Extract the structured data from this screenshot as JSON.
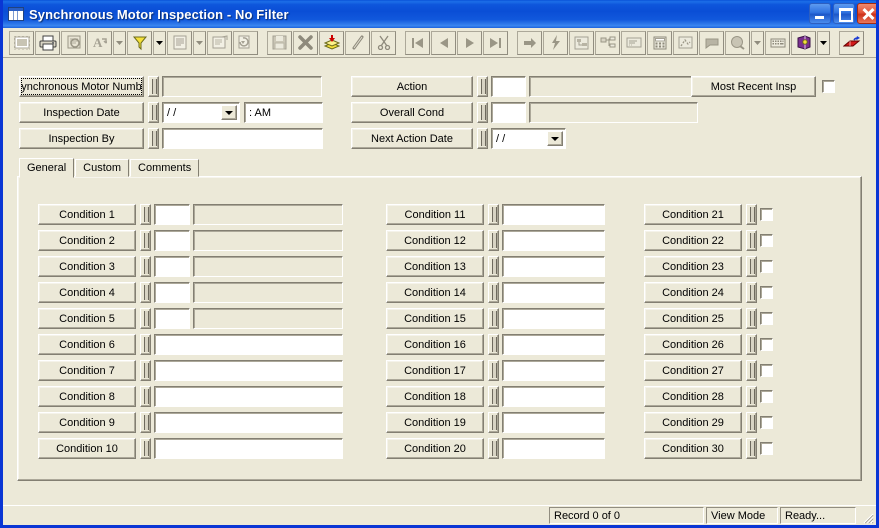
{
  "window": {
    "title": "Synchronous Motor Inspection - No Filter",
    "icon": "grid-table-icon",
    "minimize_label": "Minimize",
    "maximize_label": "Maximize",
    "close_label": "Close"
  },
  "toolbar": {
    "items": [
      {
        "name": "select-all-icon",
        "tip": "Select All",
        "disabled": true
      },
      {
        "name": "print-icon",
        "tip": "Print",
        "disabled": false
      },
      {
        "name": "print-preview-icon",
        "tip": "Print Preview",
        "disabled": true
      },
      {
        "name": "find-icon",
        "tip": "Find",
        "disabled": true
      },
      {
        "name": "find-dropdown-arrow",
        "tip": "Find Options",
        "disabled": true
      },
      {
        "name": "filter-icon",
        "tip": "Filter",
        "disabled": false
      },
      {
        "name": "filter-dropdown-arrow",
        "tip": "Filter Options",
        "disabled": false
      },
      {
        "name": "report-icon",
        "tip": "Report",
        "disabled": true
      },
      {
        "name": "report-dropdown-arrow",
        "tip": "Report Options",
        "disabled": true
      },
      {
        "name": "properties-icon",
        "tip": "Properties",
        "disabled": true
      },
      {
        "name": "refresh-icon",
        "tip": "Refresh",
        "disabled": true
      },
      {
        "name": "save-icon",
        "tip": "Save",
        "disabled": true
      },
      {
        "name": "delete-icon",
        "tip": "Delete",
        "disabled": true
      },
      {
        "name": "add-record-icon",
        "tip": "Add Record",
        "disabled": false
      },
      {
        "name": "edit-icon",
        "tip": "Edit",
        "disabled": true
      },
      {
        "name": "cut-icon",
        "tip": "Cut",
        "disabled": true
      },
      {
        "name": "first-record-icon",
        "tip": "First Record",
        "disabled": true
      },
      {
        "name": "previous-record-icon",
        "tip": "Previous Record",
        "disabled": true
      },
      {
        "name": "next-record-icon",
        "tip": "Next Record",
        "disabled": true
      },
      {
        "name": "last-record-icon",
        "tip": "Last Record",
        "disabled": true
      },
      {
        "name": "goto-record-icon",
        "tip": "Go To Record",
        "disabled": true
      },
      {
        "name": "lightning-icon",
        "tip": "Run",
        "disabled": true
      },
      {
        "name": "hierarchy-icon",
        "tip": "Hierarchy",
        "disabled": true
      },
      {
        "name": "org-chart-icon",
        "tip": "Structure",
        "disabled": true
      },
      {
        "name": "notes-icon",
        "tip": "Notes",
        "disabled": true
      },
      {
        "name": "calculator-icon",
        "tip": "Calculator",
        "disabled": true
      },
      {
        "name": "attachment-icon",
        "tip": "Attachments",
        "disabled": true
      },
      {
        "name": "comment-icon",
        "tip": "Comments",
        "disabled": true
      },
      {
        "name": "help-search-icon",
        "tip": "Search Help",
        "disabled": true
      },
      {
        "name": "help-dropdown-arrow",
        "tip": "Help Options",
        "disabled": true
      },
      {
        "name": "keyboard-icon",
        "tip": "Keyboard",
        "disabled": true
      },
      {
        "name": "book-icon",
        "tip": "Manual",
        "disabled": false
      },
      {
        "name": "book-dropdown-arrow",
        "tip": "Manual Options",
        "disabled": false
      },
      {
        "name": "exit-icon",
        "tip": "Exit",
        "disabled": false
      }
    ]
  },
  "header": {
    "left_fields": [
      {
        "label": "ynchronous Motor Numb",
        "focused": true,
        "type": "text",
        "value": "",
        "enabled": false
      },
      {
        "label": "Inspection Date",
        "focused": false,
        "type": "date-time",
        "date_value": "/ /",
        "time_value": ":     AM",
        "enabled": true
      },
      {
        "label": "Inspection By",
        "focused": false,
        "type": "text",
        "value": "",
        "enabled": true
      }
    ],
    "right_fields": [
      {
        "label": "Action",
        "type": "code-desc",
        "code_value": "",
        "desc_value": ""
      },
      {
        "label": "Overall Cond",
        "type": "code-desc",
        "code_value": "",
        "desc_value": ""
      },
      {
        "label": "Next Action Date",
        "type": "date",
        "date_value": "/ /"
      }
    ],
    "most_recent": {
      "label": "Most Recent Insp",
      "checked": false
    }
  },
  "tabs": {
    "items": [
      {
        "label": "General",
        "active": true
      },
      {
        "label": "Custom",
        "active": false
      },
      {
        "label": "Comments",
        "active": false
      }
    ]
  },
  "conditions": {
    "column1": [
      {
        "label": "Condition 1",
        "layout": "code-desc"
      },
      {
        "label": "Condition 2",
        "layout": "code-desc"
      },
      {
        "label": "Condition 3",
        "layout": "code-desc"
      },
      {
        "label": "Condition 4",
        "layout": "code-desc"
      },
      {
        "label": "Condition 5",
        "layout": "code-desc"
      },
      {
        "label": "Condition 6",
        "layout": "text"
      },
      {
        "label": "Condition 7",
        "layout": "text"
      },
      {
        "label": "Condition 8",
        "layout": "text"
      },
      {
        "label": "Condition 9",
        "layout": "text"
      },
      {
        "label": "Condition 10",
        "layout": "text"
      }
    ],
    "column2": [
      {
        "label": "Condition 11",
        "layout": "text"
      },
      {
        "label": "Condition 12",
        "layout": "text"
      },
      {
        "label": "Condition 13",
        "layout": "text"
      },
      {
        "label": "Condition 14",
        "layout": "text"
      },
      {
        "label": "Condition 15",
        "layout": "text"
      },
      {
        "label": "Condition 16",
        "layout": "text"
      },
      {
        "label": "Condition 17",
        "layout": "text"
      },
      {
        "label": "Condition 18",
        "layout": "text"
      },
      {
        "label": "Condition 19",
        "layout": "text"
      },
      {
        "label": "Condition 20",
        "layout": "text"
      }
    ],
    "column3": [
      {
        "label": "Condition 21",
        "layout": "checkbox",
        "checked": false
      },
      {
        "label": "Condition 22",
        "layout": "checkbox",
        "checked": false
      },
      {
        "label": "Condition 23",
        "layout": "checkbox",
        "checked": false
      },
      {
        "label": "Condition 24",
        "layout": "checkbox",
        "checked": false
      },
      {
        "label": "Condition 25",
        "layout": "checkbox",
        "checked": false
      },
      {
        "label": "Condition 26",
        "layout": "checkbox",
        "checked": false
      },
      {
        "label": "Condition 27",
        "layout": "checkbox",
        "checked": false
      },
      {
        "label": "Condition 28",
        "layout": "checkbox",
        "checked": false
      },
      {
        "label": "Condition 29",
        "layout": "checkbox",
        "checked": false
      },
      {
        "label": "Condition 30",
        "layout": "checkbox",
        "checked": false
      }
    ]
  },
  "status": {
    "record": "Record 0 of 0",
    "mode": "View Mode",
    "message": "Ready..."
  },
  "colors": {
    "face": "#ece9d8",
    "titlebar_blue": "#0a4ed6",
    "border_blue": "#0a36d4",
    "field_white": "#ffffff",
    "disabled_text": "#7b7768",
    "shadow": "#837f72"
  }
}
